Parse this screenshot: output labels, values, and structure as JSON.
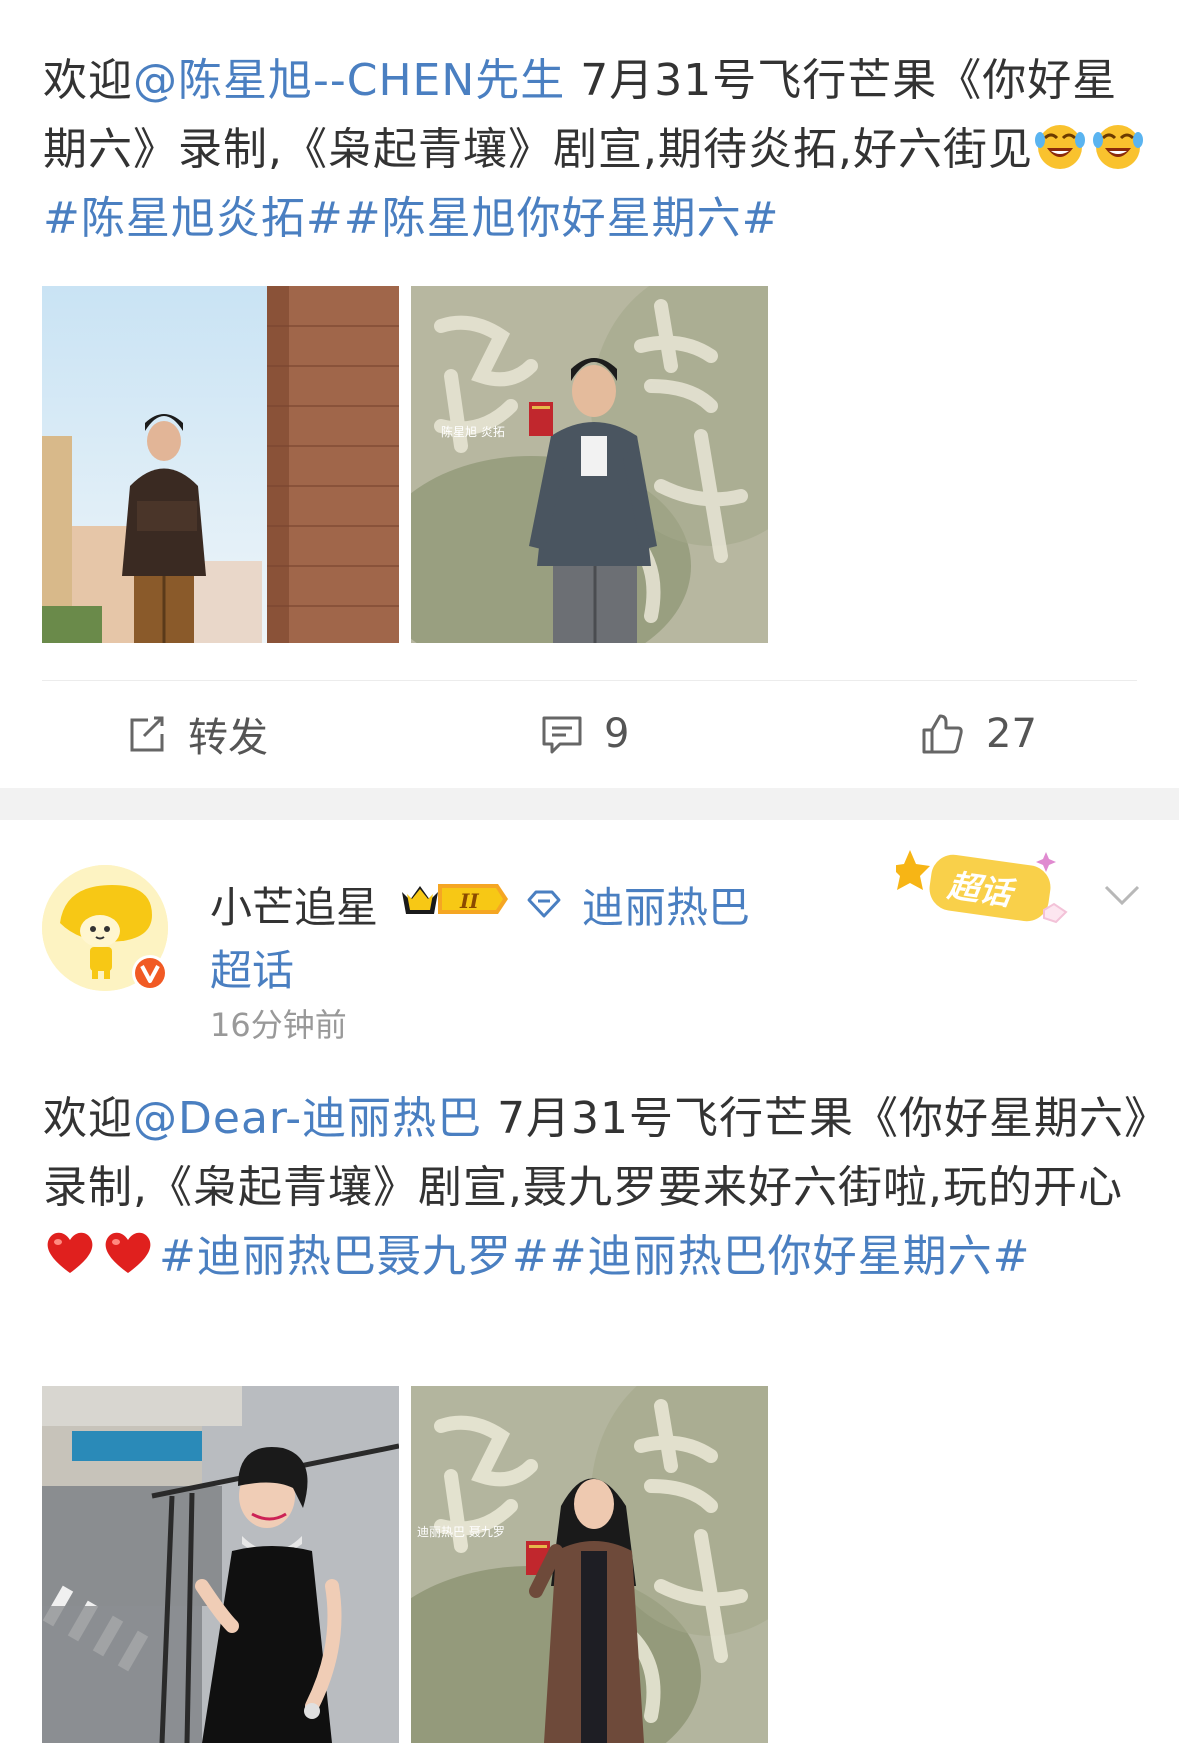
{
  "post1": {
    "text_prefix": "欢迎",
    "mention": "@陈星旭--CHEN先生",
    "text_body": " 7月31号飞行芒果《你好星期六》录制,《枭起青壤》剧宣,期待炎拓,好六街见",
    "emoji_name": "laughing-tears-emoji",
    "hashtags": "#陈星旭炎拓##陈星旭你好星期六#",
    "actions": {
      "repost_label": "转发",
      "comment_count": "9",
      "like_count": "27"
    },
    "photos": [
      {
        "icon": "man-city-street-photo"
      },
      {
        "icon": "man-poster-red-book-photo",
        "caption": "陈星旭 炎拓"
      }
    ]
  },
  "post2": {
    "username": "小芒追星",
    "vip_level": "II",
    "topic_name": "迪丽热巴",
    "topic_suffix": "超话",
    "time": "16分钟前",
    "supertopic_badge": "超话",
    "text_prefix": "欢迎",
    "mention": "@Dear-迪丽热巴",
    "text_body": " 7月31号飞行芒果《你好星期六》录制,《枭起青壤》剧宣,聂九罗要来好六街啦,玩的开心",
    "emoji_name": "red-heart-emoji",
    "hashtags": "#迪丽热巴聂九罗##迪丽热巴你好星期六#",
    "photos": [
      {
        "icon": "woman-balcony-photo"
      },
      {
        "icon": "woman-poster-red-book-photo",
        "caption": "迪丽热巴 聂九罗"
      }
    ]
  },
  "colors": {
    "link": "#4a7fc1",
    "text": "#333333",
    "muted": "#999999",
    "separator": "#f2f2f2",
    "verified": "#f15a24"
  }
}
